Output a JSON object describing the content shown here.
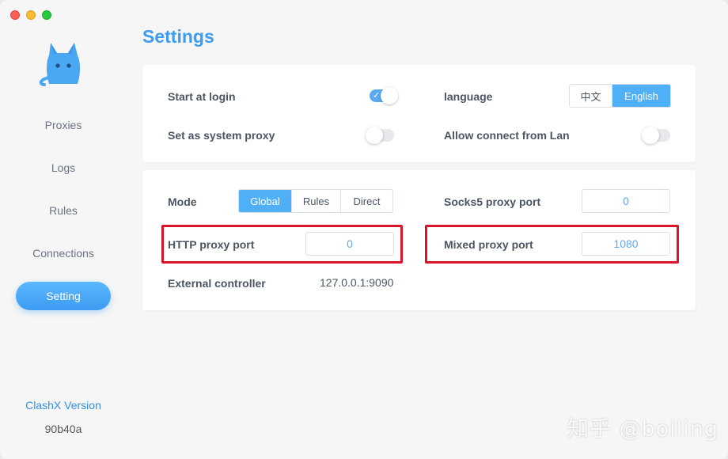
{
  "window": {
    "traffic_lights": [
      "close",
      "minimize",
      "zoom"
    ]
  },
  "sidebar": {
    "items": [
      {
        "label": "Proxies"
      },
      {
        "label": "Logs"
      },
      {
        "label": "Rules"
      },
      {
        "label": "Connections"
      },
      {
        "label": "Setting",
        "active": true
      }
    ],
    "version_label": "ClashX Version",
    "version_value": "90b40a"
  },
  "page": {
    "title": "Settings"
  },
  "general": {
    "start_at_login": {
      "label": "Start at login",
      "enabled": true
    },
    "system_proxy": {
      "label": "Set as system proxy",
      "enabled": false
    },
    "language": {
      "label": "language",
      "options": [
        "中文",
        "English"
      ],
      "selected": "English"
    },
    "allow_lan": {
      "label": "Allow connect from Lan",
      "enabled": false
    }
  },
  "proxy": {
    "mode": {
      "label": "Mode",
      "options": [
        "Global",
        "Rules",
        "Direct"
      ],
      "selected": "Global"
    },
    "socks5_port": {
      "label": "Socks5 proxy port",
      "value": "0"
    },
    "http_port": {
      "label": "HTTP proxy port",
      "value": "0"
    },
    "mixed_port": {
      "label": "Mixed proxy port",
      "value": "1080"
    },
    "external_controller": {
      "label": "External controller",
      "value": "127.0.0.1:9090"
    }
  },
  "watermark": "知乎 @boiling",
  "colors": {
    "accent": "#3d9bf2",
    "highlight": "#d9142b"
  }
}
